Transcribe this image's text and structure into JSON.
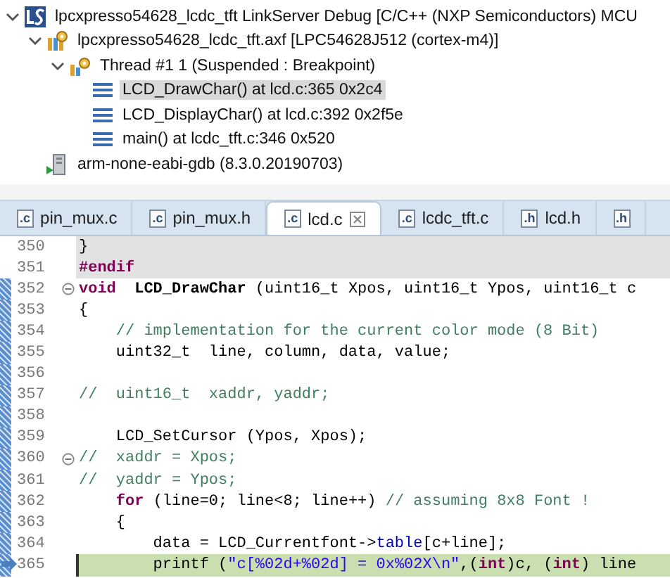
{
  "debug_tree": [
    {
      "label": "lpcxpresso54628_lcdc_tft LinkServer Debug [C/C++ (NXP Semiconductors) MCU",
      "kind": "launch",
      "expanded": true,
      "selected": false,
      "children": [
        {
          "label": "lpcxpresso54628_lcdc_tft.axf [LPC54628J512 (cortex-m4)]",
          "kind": "process",
          "expanded": true,
          "selected": false,
          "children": [
            {
              "label": "Thread #1 1 (Suspended : Breakpoint)",
              "kind": "thread",
              "expanded": true,
              "selected": false,
              "children": [
                {
                  "label": "LCD_DrawChar() at lcd.c:365 0x2c4",
                  "kind": "frame",
                  "selected": true
                },
                {
                  "label": "LCD_DisplayChar() at lcd.c:392 0x2f5e",
                  "kind": "frame",
                  "selected": false
                },
                {
                  "label": "main() at lcdc_tft.c:346 0x520",
                  "kind": "frame",
                  "selected": false
                }
              ]
            }
          ]
        },
        {
          "label": "arm-none-eabi-gdb (8.3.0.20190703)",
          "kind": "debugger",
          "selected": false
        }
      ]
    }
  ],
  "tabs": [
    {
      "icon": ".c",
      "label": "pin_mux.c",
      "selected": false
    },
    {
      "icon": ".c",
      "label": "pin_mux.h",
      "selected": false
    },
    {
      "icon": ".c",
      "label": "lcd.c",
      "selected": true
    },
    {
      "icon": ".c",
      "label": "lcdc_tft.c",
      "selected": false
    },
    {
      "icon": ".h",
      "label": "lcd.h",
      "selected": false
    },
    {
      "icon": ".h",
      "selected": false
    }
  ],
  "code_lines": [
    {
      "number": "350",
      "inactive": true,
      "changed": false,
      "foldable": false,
      "current": false,
      "tokens": [
        {
          "kind": "plain",
          "text": "}"
        }
      ]
    },
    {
      "number": "351",
      "inactive": true,
      "changed": false,
      "foldable": false,
      "current": false,
      "tokens": [
        {
          "kind": "keyword",
          "text": "#endif"
        }
      ]
    },
    {
      "number": "352",
      "inactive": false,
      "changed": true,
      "foldable": true,
      "current": false,
      "tokens": [
        {
          "kind": "keyword",
          "text": "void"
        },
        {
          "kind": "bold",
          "text": "  LCD_DrawChar"
        },
        {
          "kind": "plain",
          "text": " (uint16_t Xpos, uint16_t Ypos, uint16_t c"
        }
      ]
    },
    {
      "number": "353",
      "inactive": false,
      "changed": true,
      "foldable": false,
      "current": false,
      "tokens": [
        {
          "kind": "plain",
          "text": "{"
        }
      ]
    },
    {
      "number": "354",
      "inactive": false,
      "changed": true,
      "foldable": false,
      "current": false,
      "tokens": [
        {
          "kind": "comment",
          "text": "    // implementation for the current color mode (8 Bit)"
        }
      ]
    },
    {
      "number": "355",
      "inactive": false,
      "changed": true,
      "foldable": false,
      "current": false,
      "tokens": [
        {
          "kind": "plain",
          "text": "    uint32_t  line, column, data, value;"
        }
      ]
    },
    {
      "number": "356",
      "inactive": false,
      "changed": true,
      "foldable": false,
      "current": false
    },
    {
      "number": "357",
      "inactive": false,
      "changed": true,
      "foldable": false,
      "current": false,
      "tokens": [
        {
          "kind": "comment",
          "text": "//  uint16_t  xaddr, yaddr;"
        }
      ]
    },
    {
      "number": "358",
      "inactive": false,
      "changed": true,
      "foldable": false,
      "current": false
    },
    {
      "number": "359",
      "inactive": false,
      "changed": true,
      "foldable": false,
      "current": false,
      "tokens": [
        {
          "kind": "plain",
          "text": "    LCD_SetCursor (Ypos, Xpos);"
        }
      ]
    },
    {
      "number": "360",
      "inactive": false,
      "changed": true,
      "foldable": true,
      "current": false,
      "tokens": [
        {
          "kind": "comment",
          "text": "//  xaddr = Xpos;"
        }
      ]
    },
    {
      "number": "361",
      "inactive": false,
      "changed": true,
      "foldable": false,
      "current": false,
      "tokens": [
        {
          "kind": "comment",
          "text": "//  yaddr = Ypos;"
        }
      ]
    },
    {
      "number": "362",
      "inactive": false,
      "changed": true,
      "foldable": false,
      "current": false,
      "tokens": [
        {
          "kind": "keyword",
          "text": "    for"
        },
        {
          "kind": "plain",
          "text": " (line=0; line<8; line++) "
        },
        {
          "kind": "comment",
          "text": "// assuming 8x8 Font !"
        }
      ]
    },
    {
      "number": "363",
      "inactive": false,
      "changed": true,
      "foldable": false,
      "current": false,
      "tokens": [
        {
          "kind": "plain",
          "text": "    {"
        }
      ]
    },
    {
      "number": "364",
      "inactive": false,
      "changed": true,
      "foldable": false,
      "current": false,
      "tokens": [
        {
          "kind": "plain",
          "text": "        data = LCD_Currentfont->"
        },
        {
          "kind": "field",
          "text": "table"
        },
        {
          "kind": "plain",
          "text": "[c+line];"
        }
      ]
    },
    {
      "number": "365",
      "inactive": false,
      "changed": true,
      "foldable": false,
      "current": true,
      "tokens": [
        {
          "kind": "plain",
          "text": "        printf ("
        },
        {
          "kind": "string",
          "text": "\"c[%02d+%02d] = 0x%02X\\n\""
        },
        {
          "kind": "plain",
          "text": ",("
        },
        {
          "kind": "keyword",
          "text": "int"
        },
        {
          "kind": "plain",
          "text": ")c, ("
        },
        {
          "kind": "keyword",
          "text": "int"
        },
        {
          "kind": "plain",
          "text": ") line"
        }
      ]
    }
  ]
}
